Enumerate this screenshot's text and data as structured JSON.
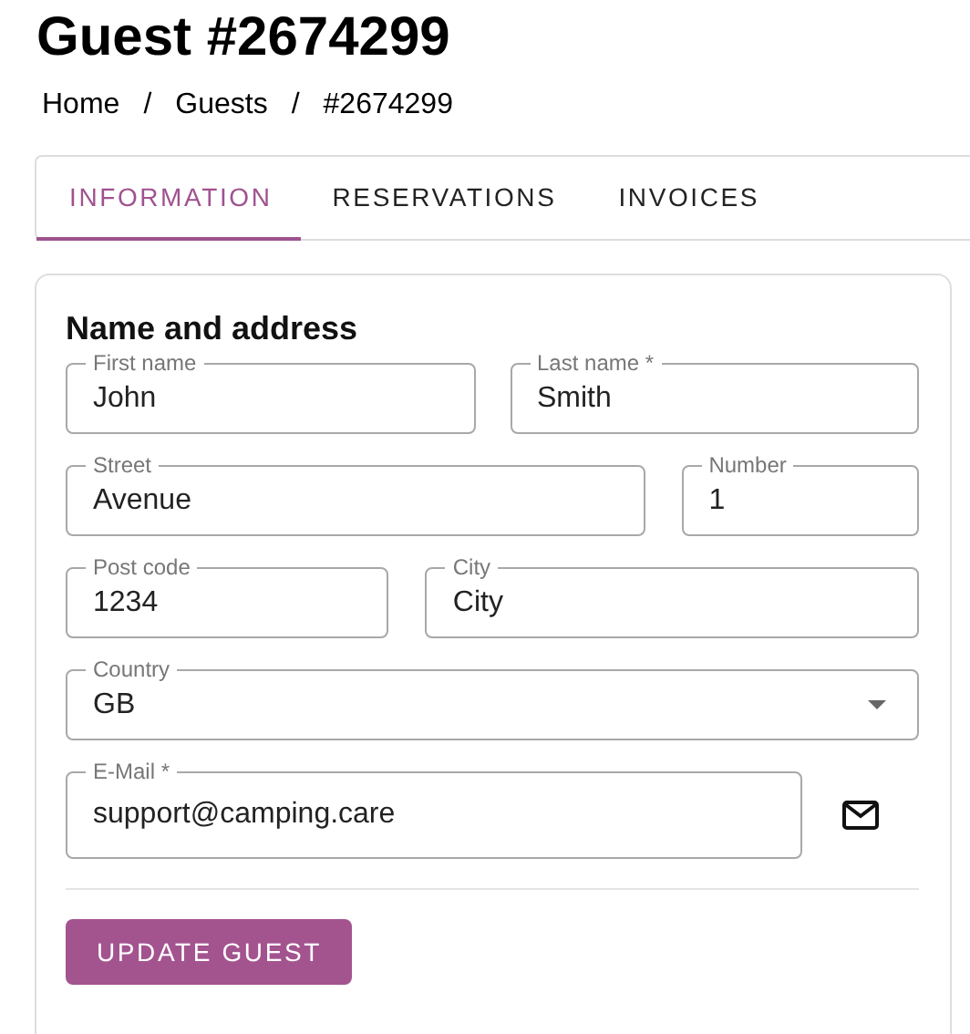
{
  "title": "Guest #2674299",
  "breadcrumb": [
    {
      "label": "Home"
    },
    {
      "label": "Guests"
    },
    {
      "label": "#2674299"
    }
  ],
  "breadcrumb_separator": "/",
  "tabs": [
    {
      "label": "INFORMATION",
      "selected": true
    },
    {
      "label": "RESERVATIONS",
      "selected": false
    },
    {
      "label": "INVOICES",
      "selected": false
    }
  ],
  "card": {
    "heading": "Name and address",
    "rows": [
      [
        {
          "kind": "text",
          "label": "First name",
          "value": "John"
        },
        {
          "kind": "text",
          "label": "Last name *",
          "value": "Smith"
        }
      ],
      [
        {
          "kind": "text",
          "label": "Street",
          "value": "Avenue"
        },
        {
          "kind": "text",
          "label": "Number",
          "value": "1"
        }
      ],
      [
        {
          "kind": "text",
          "label": "Post code",
          "value": "1234"
        },
        {
          "kind": "text",
          "label": "City",
          "value": "City"
        }
      ],
      [
        {
          "kind": "select",
          "label": "Country",
          "value": "GB"
        }
      ],
      [
        {
          "kind": "email",
          "label": "E-Mail *",
          "value": "support@camping.care"
        }
      ]
    ],
    "button": "UPDATE GUEST"
  }
}
